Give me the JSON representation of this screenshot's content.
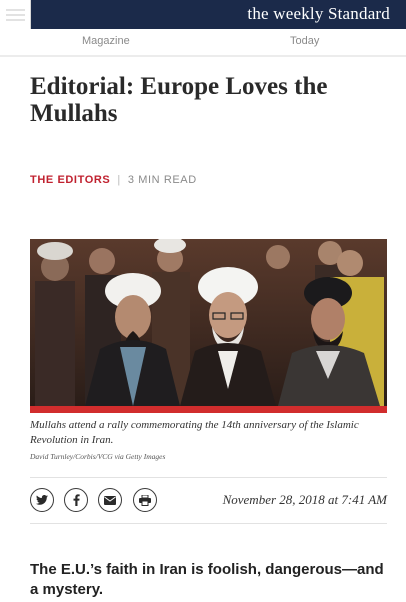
{
  "header": {
    "brand": "the weekly Standard",
    "icons": {
      "menu": "hamburger-menu-icon"
    },
    "colors": {
      "bar": "#1b2a4a",
      "brand_text": "#ffffff"
    }
  },
  "nav": {
    "tabs": [
      {
        "label": "Magazine"
      },
      {
        "label": "Today"
      }
    ]
  },
  "article": {
    "title": "Editorial: Europe Loves the Mullahs",
    "author": "THE EDITORS",
    "separator": "|",
    "read_time": "3 MIN READ",
    "accent_color": "#c0212f",
    "image": {
      "caption": "Mullahs attend a rally commemorating the 14th anniversary of the Islamic Revolution in Iran.",
      "credit": "David Turnley/Corbis/VCG via Getty Images"
    },
    "share_icons": [
      "twitter-icon",
      "facebook-icon",
      "email-icon",
      "print-icon"
    ],
    "date": "November 28, 2018 at 7:41 AM",
    "dek": "The E.U.’s faith in Iran is foolish, dangerous—and a mystery."
  }
}
